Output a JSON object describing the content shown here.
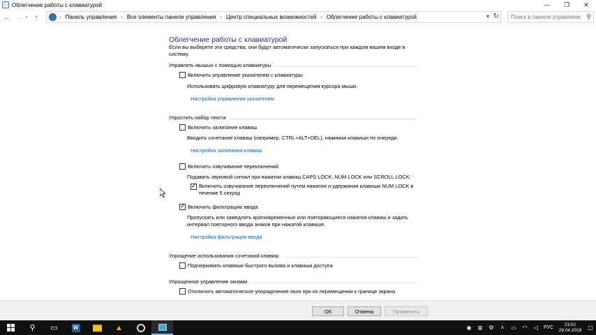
{
  "window": {
    "title": "Облегчение работы с клавиатурой",
    "minimize": "—",
    "maximize": "❐",
    "close": "✕"
  },
  "nav": {
    "back": "←",
    "forward": "→",
    "up": "↑",
    "breadcrumbs": [
      "Панель управления",
      "Все элементы панели управления",
      "Центр специальных возможностей",
      "Облегчение работы с клавиатурой"
    ],
    "search_placeholder": "Поиск в панели управления"
  },
  "page": {
    "title": "Облегчение работы с клавиатурой",
    "intro": "Если вы выберете эти средства, они будут автоматически запускаться при каждом вашем входе в систему.",
    "mouse": {
      "heading": "Управлять мышью с помощью клавиатуры",
      "mousekeys_label": "Включить управление указателем с клавиатуры",
      "mousekeys_checked": false,
      "mousekeys_desc": "Использовать цифровую клавиатуру для перемещения курсора мыши.",
      "mousekeys_link": "Настройка управления указателем"
    },
    "typing": {
      "heading": "Упростить набор текста",
      "sticky_label": "Включить залипание клавиш",
      "sticky_checked": false,
      "sticky_desc": "Вводить сочетание клавиш (например, CTRL+ALT+DEL), нажимая клавиши по очереди.",
      "sticky_link": "Настройка залипания клавиш",
      "toggle_label": "Включить озвучивание переключений",
      "toggle_checked": false,
      "toggle_desc": "Подавать звуковой сигнал при нажатии клавиш CAPS LOCK, NUM LOCK или SCROLL LOCK.",
      "toggle_hold_label_1": "Включить озвучивание переключений путем нажатия и удержания клавиши NUM LOCK в",
      "toggle_hold_label_2": "течение 5 секунд",
      "toggle_hold_checked": true,
      "filter_label": "Включить фильтрацию ввода",
      "filter_checked": true,
      "filter_desc_1": "Пропускать или замедлять кратковременные или повторяющиеся нажатия клавиш и задать",
      "filter_desc_2": "интервал повторного ввода знаков при нажатой клавише.",
      "filter_link": "Настройка фильтрации ввода"
    },
    "shortcuts": {
      "heading": "Упрощение использования сочетаний клавиш",
      "underline_label": "Подчеркивать клавиши быстрого вызова и клавиши доступа",
      "underline_checked": false
    },
    "windows": {
      "heading": "Упрощенное управление окнами",
      "snap_label": "Отключить автоматическое упорядочение окон при их перемещении к границе экрана",
      "snap_checked": false
    }
  },
  "footer": {
    "ok": "ОК",
    "cancel": "Отмена",
    "apply": "Применить"
  },
  "taskbar": {
    "lang": "РУС",
    "time": "23:02",
    "date": "26.04.2018"
  }
}
